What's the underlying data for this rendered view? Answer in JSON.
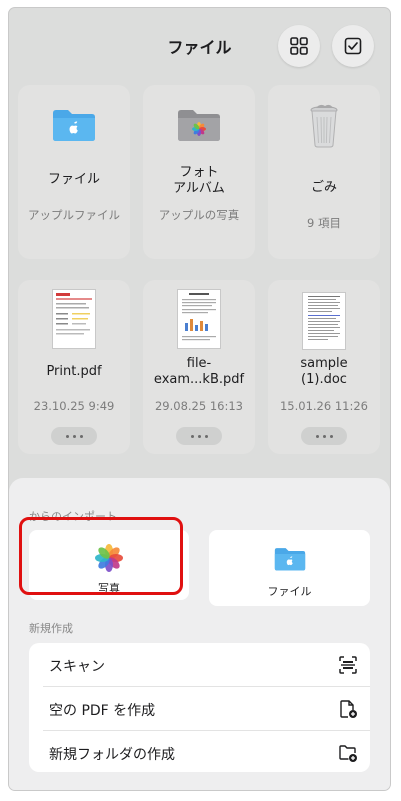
{
  "header": {
    "title": "ファイル"
  },
  "toolbar": {
    "view_icon": "grid-view-icon",
    "select_icon": "checkbox-select-icon"
  },
  "items": [
    {
      "name": "ファイル",
      "subtitle": "アップルファイル",
      "icon": "blue-folder-icon"
    },
    {
      "name": "フォト\nアルバム",
      "subtitle": "アップルの写真",
      "icon": "photos-folder-icon"
    },
    {
      "name": "ごみ",
      "subtitle": "9 項目",
      "icon": "trash-can-icon"
    },
    {
      "name": "Print.pdf",
      "subtitle": "23.10.25 9:49",
      "icon": "pdf-thumbnail-icon"
    },
    {
      "name": "file-\nexam...kB.pdf",
      "subtitle": "29.08.25 16:13",
      "icon": "pdf-thumbnail-icon"
    },
    {
      "name": "sample\n(1).doc",
      "subtitle": "15.01.26 11:26",
      "icon": "doc-thumbnail-icon"
    }
  ],
  "import_sheet": {
    "section_import": "からのインポート",
    "photos_label": "写真",
    "files_label": "ファイル",
    "section_create": "新規作成",
    "actions": [
      {
        "label": "スキャン",
        "icon": "scan-icon"
      },
      {
        "label": "空の PDF を作成",
        "icon": "new-pdf-icon"
      },
      {
        "label": "新規フォルダの作成",
        "icon": "new-folder-icon"
      }
    ]
  },
  "colors": {
    "accent_blue": "#4aa8e8",
    "highlight_red": "#e01010"
  }
}
